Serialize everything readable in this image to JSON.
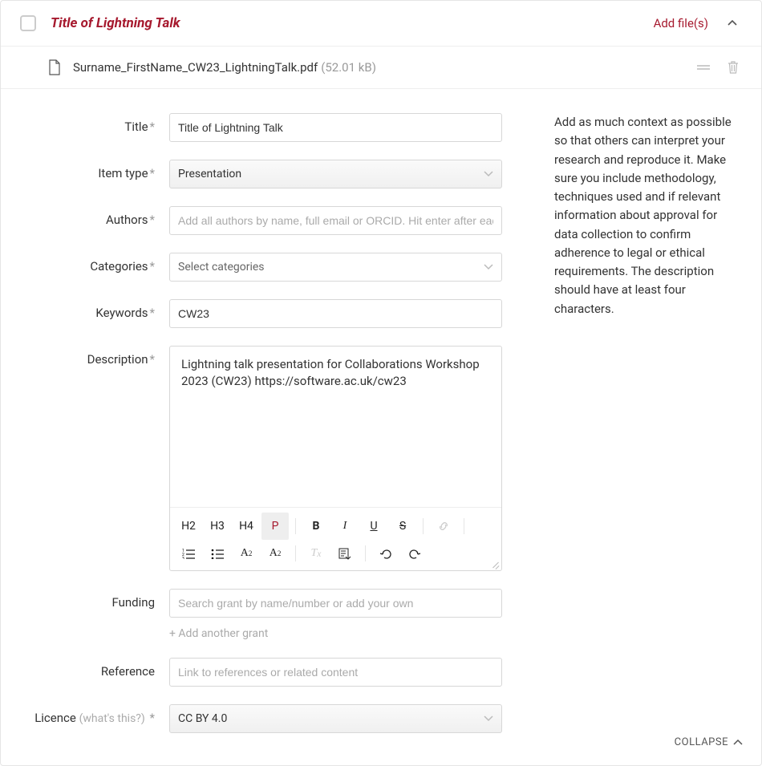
{
  "header": {
    "title": "Title of Lightning Talk",
    "add_files": "Add file(s)"
  },
  "file": {
    "name": "Surname_FirstName_CW23_LightningTalk.pdf",
    "size": "(52.01 kB)"
  },
  "labels": {
    "title": "Title",
    "item_type": "Item type",
    "authors": "Authors",
    "categories": "Categories",
    "keywords": "Keywords",
    "description": "Description",
    "funding": "Funding",
    "reference": "Reference",
    "licence": "Licence",
    "licence_hint": "(what's this?)",
    "required_marker": "*"
  },
  "values": {
    "title": "Title of Lightning Talk",
    "item_type": "Presentation",
    "categories_placeholder": "Select categories",
    "authors_placeholder": "Add all authors by name, full email or ORCID. Hit enter after each.",
    "keywords": "CW23",
    "description": "Lightning talk presentation for Collaborations Workshop 2023 (CW23) https://software.ac.uk/cw23",
    "funding_placeholder": "Search grant by name/number or add your own",
    "add_grant": "+ Add another grant",
    "reference_placeholder": "Link to references or related content",
    "licence": "CC BY 4.0"
  },
  "toolbar": {
    "h2": "H2",
    "h3": "H3",
    "h4": "H4",
    "p": "P",
    "bold": "B",
    "italic": "I",
    "underline": "U",
    "strike": "S"
  },
  "help_text": "Add as much context as possible so that others can interpret your research and reproduce it. Make sure you include methodology, techniques used and if relevant information about approval for data collection to confirm adherence to legal or ethical requirements. The description should have at least four characters.",
  "footer": {
    "collapse": "COLLAPSE"
  }
}
